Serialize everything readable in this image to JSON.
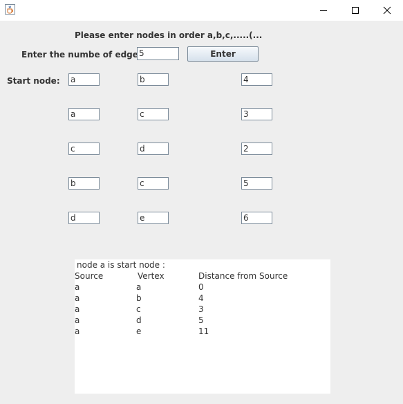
{
  "window": {
    "icon": "java-cup-icon",
    "controls": [
      "minimize-icon",
      "maximize-icon",
      "close-icon"
    ]
  },
  "form": {
    "instruction": "Please enter nodes in order a,b,c,.....(...",
    "edges_label": "Enter the numbe of edges:",
    "edges_value": "5",
    "enter_label": "Enter",
    "start_node_label": "Start node:"
  },
  "edges": [
    {
      "from": "a",
      "to": "b",
      "weight": "4"
    },
    {
      "from": "a",
      "to": "c",
      "weight": "3"
    },
    {
      "from": "c",
      "to": "d",
      "weight": "2"
    },
    {
      "from": "b",
      "to": "c",
      "weight": "5"
    },
    {
      "from": "d",
      "to": "e",
      "weight": "6"
    }
  ],
  "output": {
    "start_msg": "node a is start node :",
    "headers": [
      "Source",
      "Vertex",
      "Distance from Source"
    ],
    "rows": [
      [
        "a",
        "a",
        "0"
      ],
      [
        "a",
        "b",
        "4"
      ],
      [
        "a",
        "c",
        "3"
      ],
      [
        "a",
        "d",
        "5"
      ],
      [
        "a",
        "e",
        "11"
      ]
    ]
  }
}
